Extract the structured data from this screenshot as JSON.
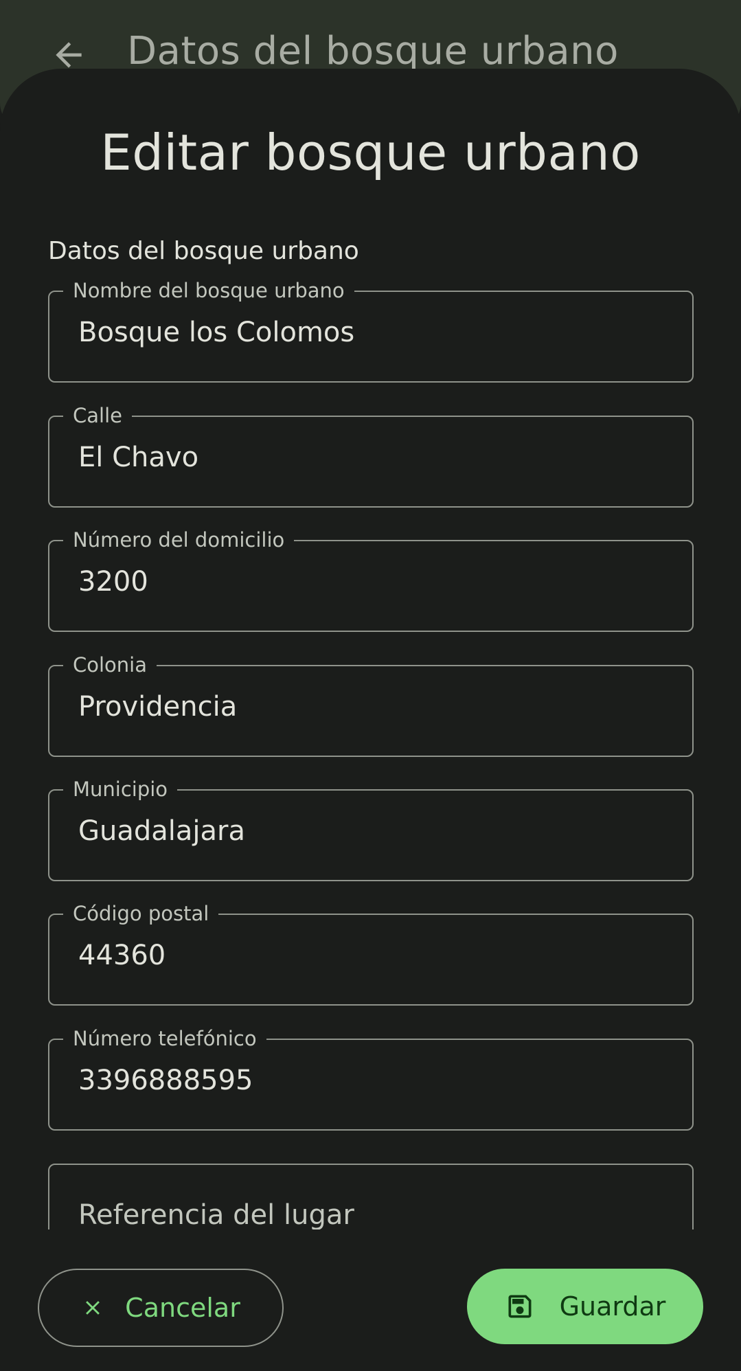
{
  "background_screen": {
    "title": "Datos del bosque urbano"
  },
  "sheet": {
    "title": "Editar bosque urbano",
    "section_label": "Datos del bosque urbano"
  },
  "fields": [
    {
      "label": "Nombre del bosque urbano",
      "value": "Bosque los Colomos"
    },
    {
      "label": "Calle",
      "value": "El Chavo"
    },
    {
      "label": "Número del domicilio",
      "value": "3200"
    },
    {
      "label": "Colonia",
      "value": "Providencia"
    },
    {
      "label": "Municipio",
      "value": "Guadalajara"
    },
    {
      "label": "Código postal",
      "value": "44360"
    },
    {
      "label": "Número telefónico",
      "value": "3396888595"
    }
  ],
  "reference_field": {
    "placeholder": "Referencia del lugar"
  },
  "actions": {
    "cancel_label": "Cancelar",
    "save_label": "Guardar"
  },
  "colors": {
    "background": "#1b1d1b",
    "top_bar": "#2c3329",
    "accent_green": "#7fd97f",
    "outline": "#8f938b",
    "text_primary": "#e3e4dc"
  },
  "icons": {
    "back": "arrow-back-icon",
    "cancel": "close-icon",
    "save": "save-icon"
  }
}
